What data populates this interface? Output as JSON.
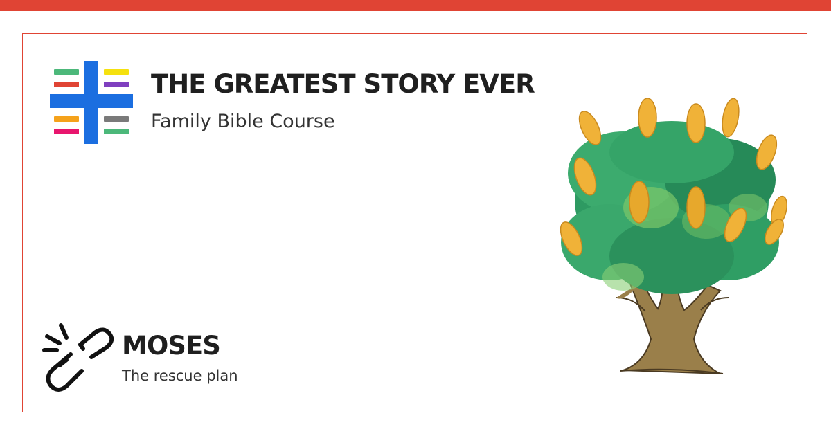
{
  "header": {
    "title": "THE GREATEST STORY EVER",
    "subtitle": "Family Bible Course"
  },
  "lesson": {
    "title": "MOSES",
    "subtitle": "The rescue plan"
  },
  "icons": {
    "logo": "cross-color-bars-logo",
    "lesson_icon": "broken-chain-icon",
    "illustration": "watercolor-tree-illustration"
  },
  "colors": {
    "accent": "#e04434",
    "logo_blue": "#1b6ee0",
    "logo_green": "#4cb87a",
    "logo_red": "#e04434",
    "logo_yellow": "#f5e10f",
    "logo_purple": "#7f3fbf",
    "logo_orange": "#f5a21b",
    "logo_pink": "#e8166e",
    "logo_gray": "#7a7a7a",
    "text_dark": "#1f1f1f",
    "leaf_green": "#2e9a62",
    "fruit_gold": "#f0b238",
    "trunk_brown": "#9a7f4a"
  }
}
